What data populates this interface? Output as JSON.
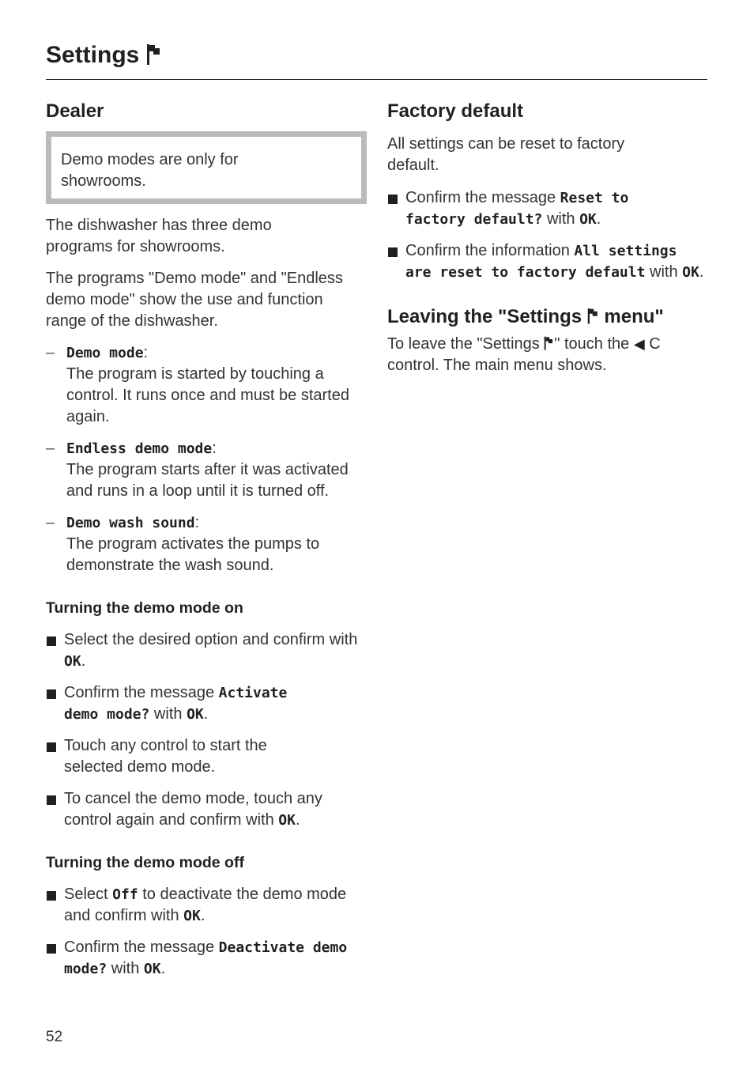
{
  "header": {
    "title": "Settings",
    "title_icon": "flag-icon"
  },
  "left": {
    "dealer": {
      "heading": "Dealer",
      "note": "Demo modes are only for showrooms.",
      "intro1": "The dishwasher has three demo programs for showrooms.",
      "intro2": "The programs \"Demo mode\" and \"Endless demo mode\" show the use and function range of the dishwasher.",
      "modes": [
        {
          "name": "Demo mode",
          "description": "The program is started by touching a control. It runs once and must be started again."
        },
        {
          "name": "Endless demo mode",
          "description": "The program starts after it was activated and runs in a loop until it is turned off."
        },
        {
          "name": "Demo wash sound",
          "description": "The program activates the pumps to demonstrate the wash sound."
        }
      ]
    },
    "turning_on": {
      "heading": "Turning the demo mode on",
      "steps": [
        {
          "pre": "Select the desired option and confirm with ",
          "lcd": "OK",
          "post": "."
        },
        {
          "pre": "Confirm the message ",
          "lcd": "Activate demo mode?",
          "mid": " with ",
          "lcd2": "OK",
          "post": "."
        },
        {
          "pre": "Touch any control to start the selected demo mode."
        },
        {
          "pre": "To cancel the demo mode, touch any control again and confirm with ",
          "lcd": "OK",
          "post": "."
        }
      ]
    },
    "turning_off": {
      "heading": "Turning the demo mode off",
      "steps": [
        {
          "pre": "Select ",
          "lcd": "Off",
          "mid": " to deactivate the demo mode and confirm with ",
          "lcd2": "OK",
          "post": "."
        },
        {
          "pre": "Confirm the message ",
          "lcd": "Deactivate demo mode?",
          "mid": " with ",
          "lcd2": "OK",
          "post": "."
        }
      ]
    }
  },
  "right": {
    "factory": {
      "heading": "Factory default",
      "intro": "All settings can be reset to factory default.",
      "steps": [
        {
          "pre": "Confirm the message ",
          "lcd": "Reset to factory default?",
          "mid": " with ",
          "lcd2": "OK",
          "post": "."
        },
        {
          "pre": "Confirm the information ",
          "lcd": "All settings are reset to factory default",
          "mid": " with ",
          "lcd2": "OK",
          "post": "."
        }
      ]
    },
    "leaving": {
      "heading_pre": "Leaving the \"Settings ",
      "heading_post": " menu\"",
      "text_pre": "To leave the \"Settings ",
      "text_mid": "\" touch the ",
      "back_icon": "◀",
      "text_post": " C control. The main menu shows."
    }
  },
  "footer": {
    "page_number": "52"
  }
}
